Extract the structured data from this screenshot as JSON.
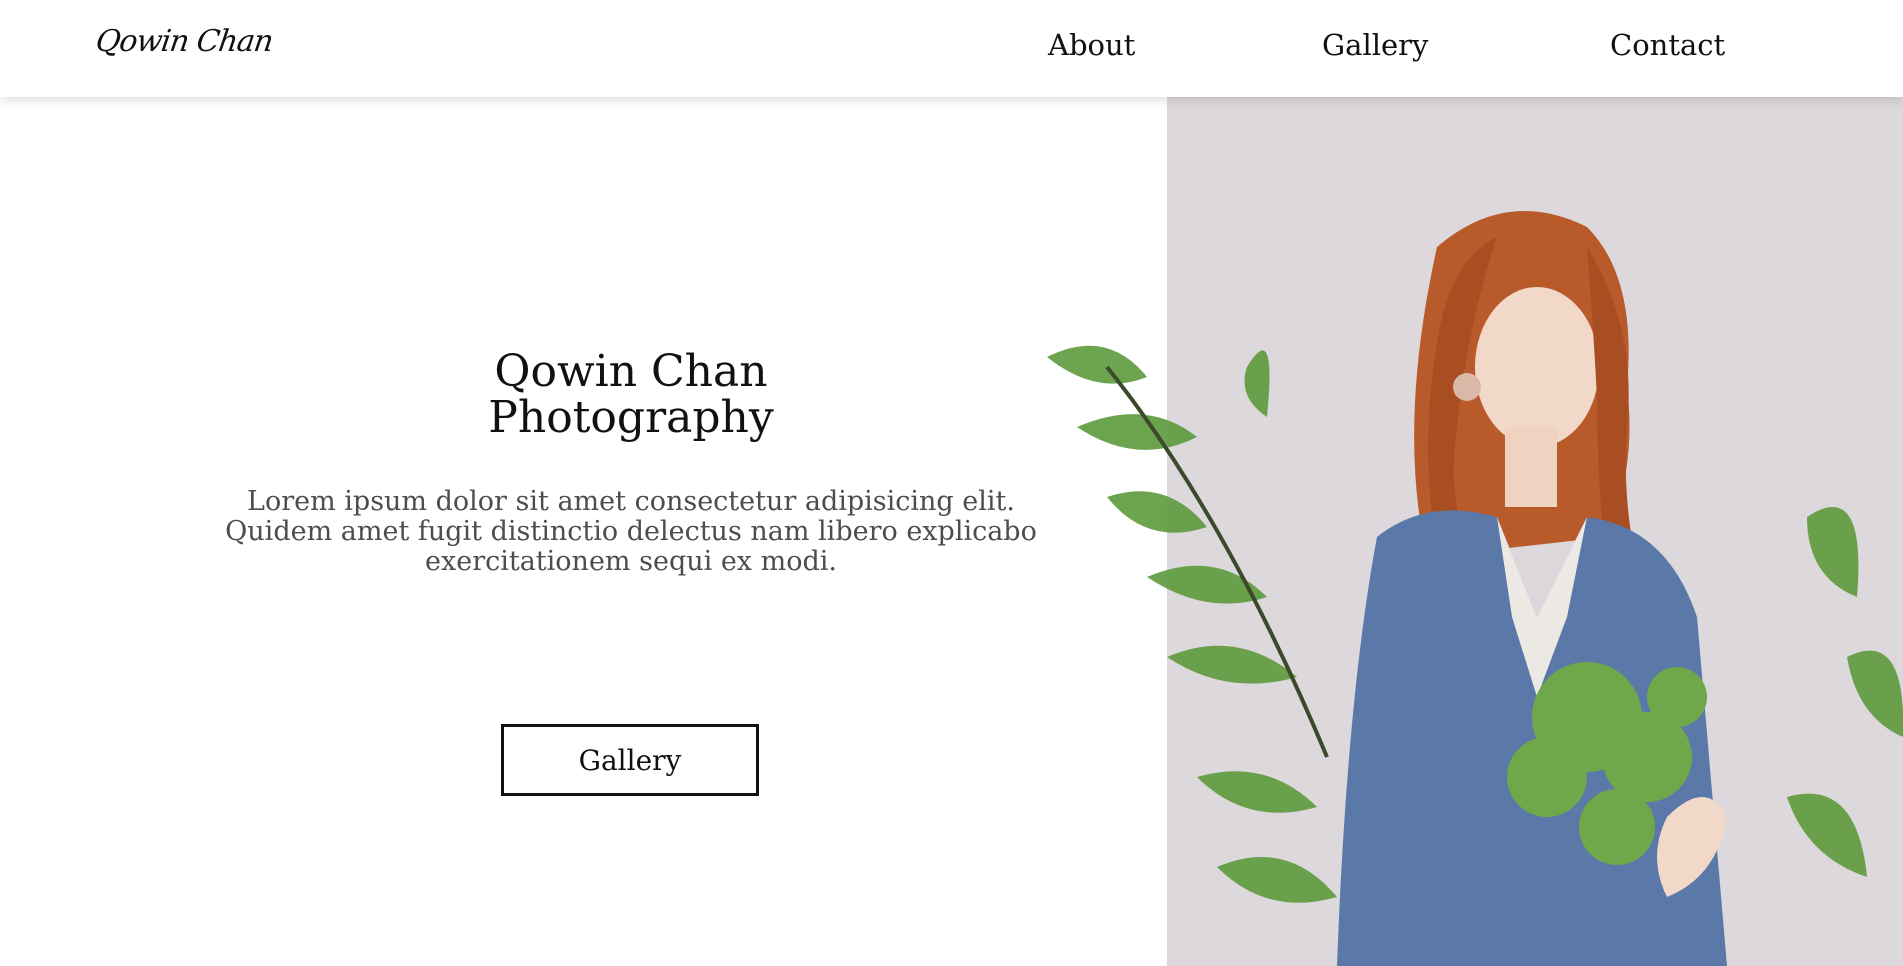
{
  "header": {
    "logo": "Qowin Chan",
    "nav": [
      {
        "label": "About"
      },
      {
        "label": "Gallery"
      },
      {
        "label": "Contact"
      }
    ]
  },
  "hero": {
    "title_line1": "Qowin Chan",
    "title_line2": "Photography",
    "description": "Lorem ipsum dolor sit amet consectetur adipisicing elit. Quidem amet fugit distinctio delectus nam libero explicabo exercitationem sequi ex modi.",
    "button_label": "Gallery"
  },
  "colors": {
    "background": "#ffffff",
    "text": "#111111",
    "muted_text": "#4d4d4d",
    "photo_backdrop": "#dcd8dc",
    "hair": "#b85a2a",
    "sweater": "#5a78a8",
    "leaves": "#5d9a3c"
  }
}
